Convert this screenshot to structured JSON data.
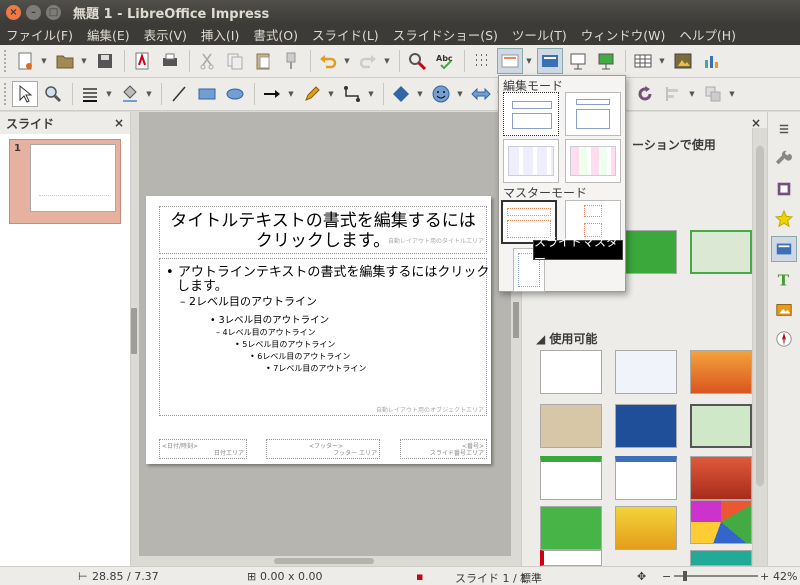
{
  "window": {
    "title": "無題 1 - LibreOffice Impress"
  },
  "menu": [
    "ファイル(F)",
    "編集(E)",
    "表示(V)",
    "挿入(I)",
    "書式(O)",
    "スライド(L)",
    "スライドショー(S)",
    "ツール(T)",
    "ウィンドウ(W)",
    "ヘルプ(H)"
  ],
  "slide_pane": {
    "title": "スライド",
    "close": "×",
    "thumb_number": "1"
  },
  "slide": {
    "title_line1": "タイトルテキストの書式を編集するには",
    "title_line2": "クリックします。",
    "title_area_note": "自動レイアウト用のタイトルエリア",
    "outline": [
      "アウトラインテキストの書式を編集するにはクリック",
      "します。",
      "2レベル目のアウトライン",
      "3レベル目のアウトライン",
      "4レベル目のアウトライン",
      "5レベル目のアウトライン",
      "6レベル目のアウトライン",
      "7レベル目のアウトライン"
    ],
    "outline_area_note": "自動レイアウト用のオブジェクトエリア",
    "footer_left_label": "<日付/時刻>",
    "footer_left_note": "日付エリア",
    "footer_center_label": "<フッター>",
    "footer_center_note": "フッター エリア",
    "footer_right_label": "<番号>",
    "footer_right_note": "スライド番号エリア"
  },
  "layout_popup": {
    "edit_mode_heading": "編集モード",
    "master_mode_heading": "マスターモード",
    "tooltip": "スライドマスター"
  },
  "task_pane": {
    "close": "×",
    "used_in_presentation": "ーションで使用",
    "available_heading": "使用可能"
  },
  "status": {
    "position": "28.85 / 7.37",
    "size": "0.00 x 0.00",
    "slide": "スライド 1 / 1",
    "master": "標準",
    "zoom": "42%"
  },
  "colors": {
    "titlebar": "#3c3b37",
    "close_button": "#f07746",
    "thumb_selected": "#e7b1a0",
    "workspace_bg": "#b7b5b0"
  }
}
